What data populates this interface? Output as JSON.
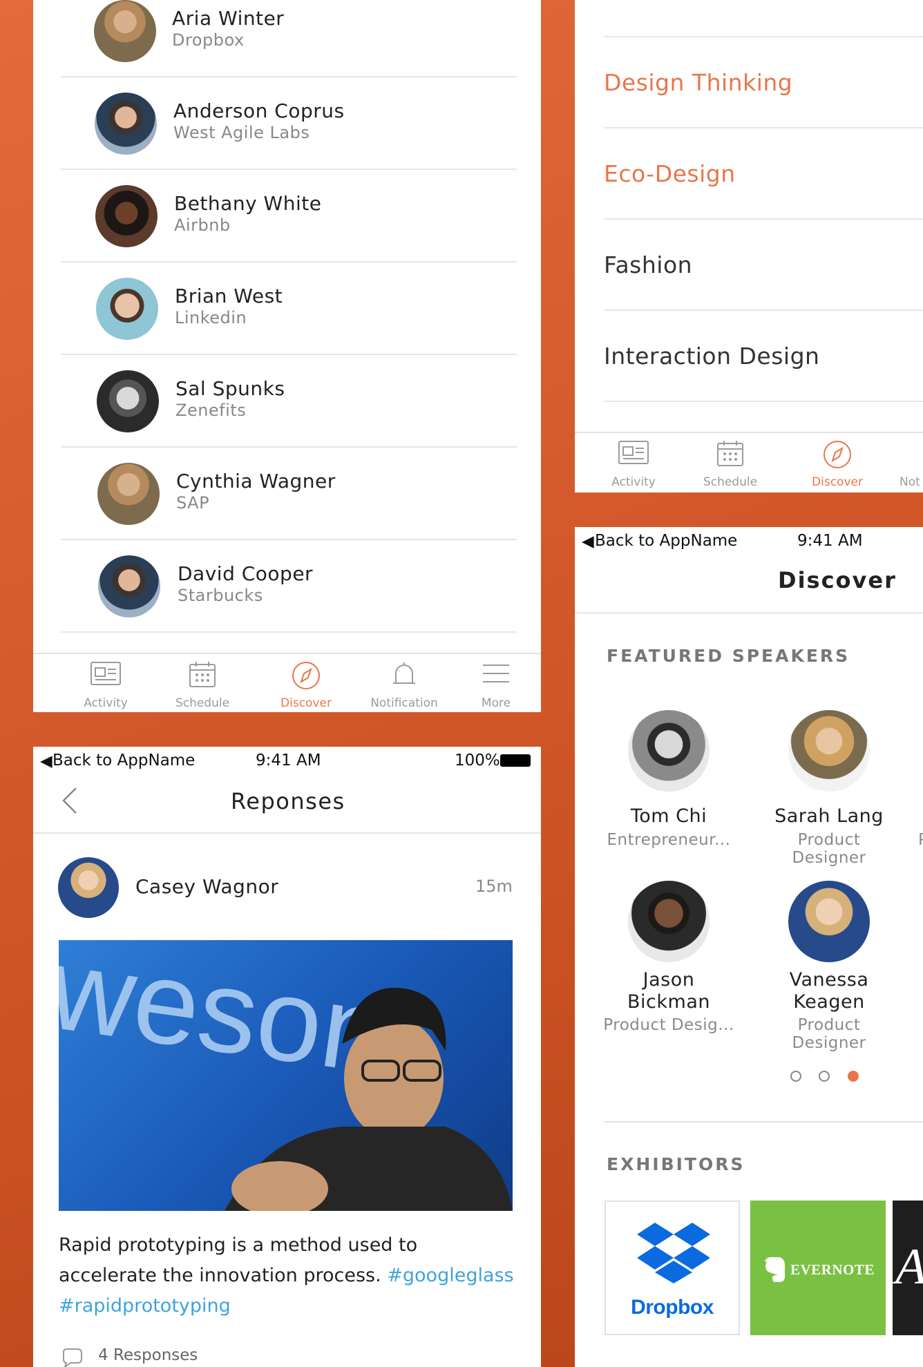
{
  "colors": {
    "accent": "#e8764a",
    "link": "#3ea3e0",
    "inactive": "#9a9a9a",
    "evernote": "#7ac143",
    "dropbox": "#0a6ae0"
  },
  "people": [
    {
      "name": "Aria Winter",
      "company": "Dropbox"
    },
    {
      "name": "Anderson Coprus",
      "company": "West Agile Labs"
    },
    {
      "name": "Bethany White",
      "company": "Airbnb"
    },
    {
      "name": "Brian West",
      "company": "Linkedin"
    },
    {
      "name": "Sal Spunks",
      "company": "Zenefits"
    },
    {
      "name": "Cynthia Wagner",
      "company": "SAP"
    },
    {
      "name": "David Cooper",
      "company": "Starbucks"
    }
  ],
  "tabbar": {
    "activity": "Activity",
    "schedule": "Schedule",
    "discover": "Discover",
    "notification": "Notification",
    "more": "More",
    "notification_cut": "Not"
  },
  "topics": [
    "Design Thinking",
    "Eco-Design",
    "Fashion",
    "Interaction Design"
  ],
  "responses": {
    "status": {
      "back": "Back to AppName",
      "time": "9:41 AM",
      "battery": "100%"
    },
    "title": "Reponses",
    "post": {
      "author": "Casey Wagnor",
      "time": "15m",
      "text": "Rapid prototyping is a method used to accelerate the innovation process.",
      "tag1": "#googleglass",
      "tag2": "#rapidprototyping",
      "responses": "4 Responses"
    }
  },
  "discover": {
    "status": {
      "back": "Back to AppName",
      "time": "9:41 AM"
    },
    "title": "Discover",
    "featured_heading": "FEATURED SPEAKERS",
    "speakers": [
      {
        "name": "Tom Chi",
        "role": "Entrepreneur..."
      },
      {
        "name": "Sarah Lang",
        "role": "Product Designer"
      },
      {
        "name": "Jason Bickman",
        "role": "Product Desig..."
      },
      {
        "name": "Vanessa Keagen",
        "role": "Product Designer"
      }
    ],
    "page_dots": {
      "total": 3,
      "active": 3
    },
    "exhibitors_heading": "EXHIBITORS",
    "exhibitors": [
      "Dropbox",
      "EVERNOTE"
    ]
  }
}
